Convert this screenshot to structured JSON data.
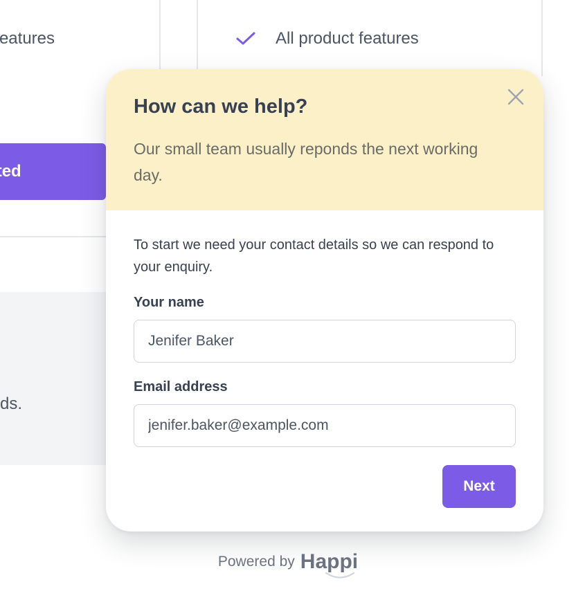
{
  "background": {
    "left_feature_text": "features",
    "feature_item": "All product features",
    "cta_label": "Get started",
    "grey_panel_text": "ds.",
    "accent_color": "#7c5ce6"
  },
  "widget": {
    "title": "How can we help?",
    "subtitle": "Our small team usually reponds the next working day.",
    "close_icon": "close-icon",
    "intro": "To start we need your contact details so we can respond to your enquiry.",
    "name_label": "Your name",
    "name_value": "Jenifer Baker",
    "email_label": "Email address",
    "email_value": "jenifer.baker@example.com",
    "next_label": "Next",
    "header_color": "#fbf0c8"
  },
  "footer": {
    "powered_label": "Powered by",
    "brand": "Happi"
  }
}
